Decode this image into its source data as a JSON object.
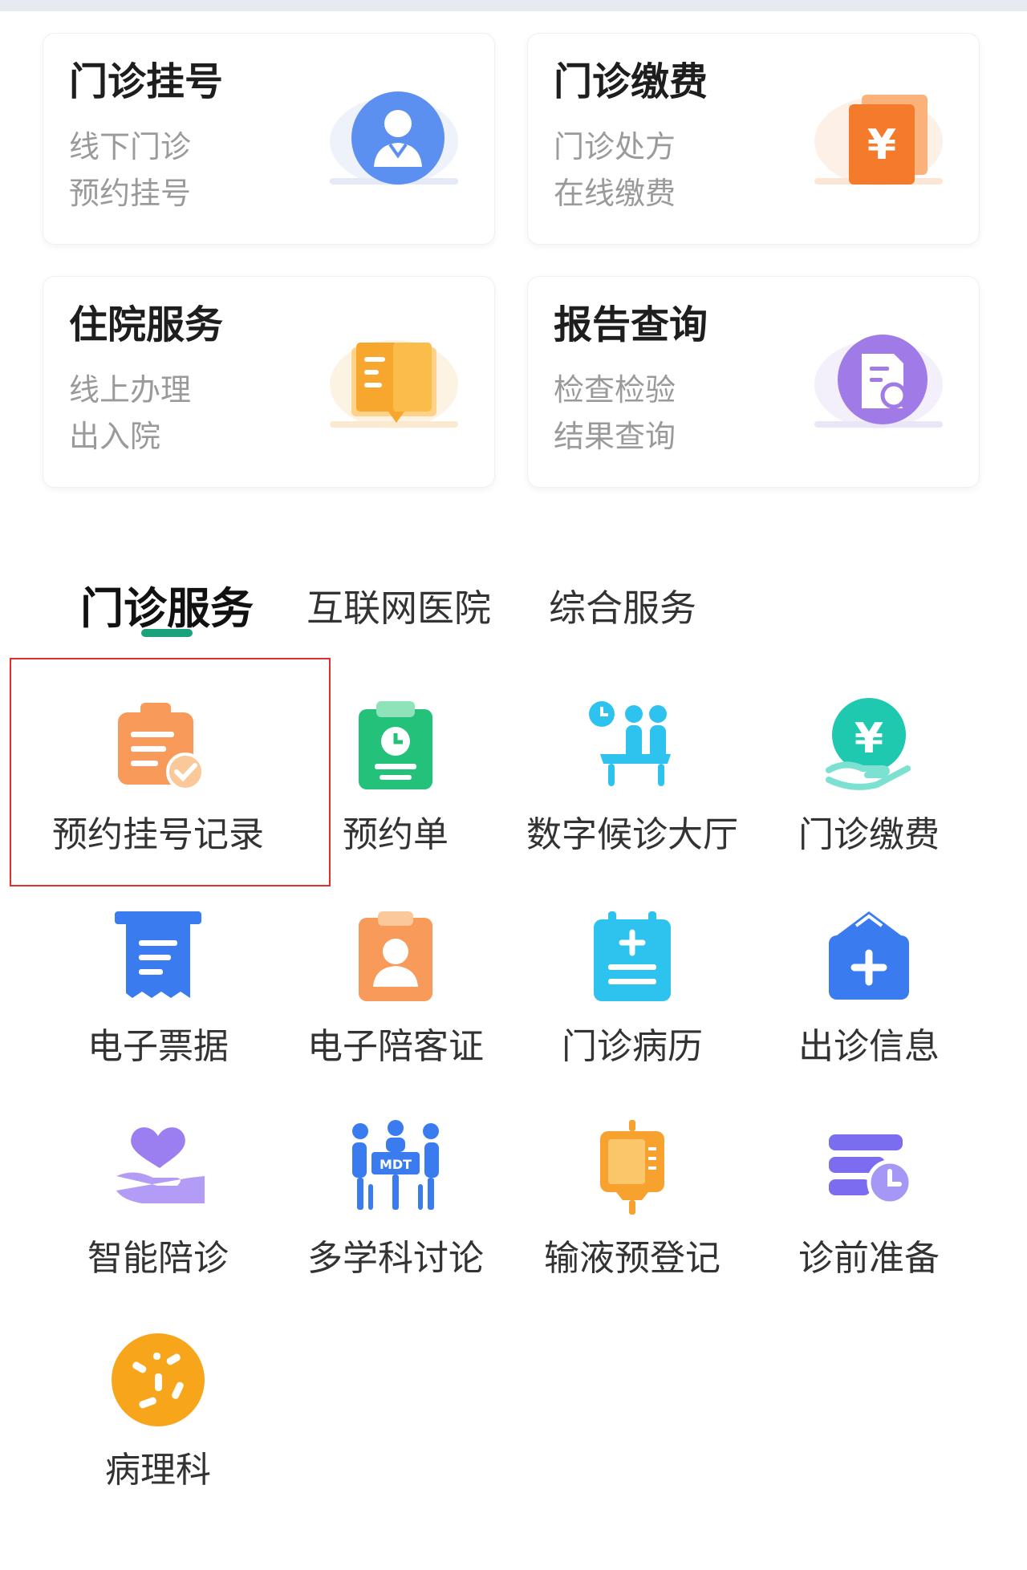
{
  "cards": [
    {
      "title": "门诊挂号",
      "sub1": "线下门诊",
      "sub2": "预约挂号",
      "icon": "doctor-icon"
    },
    {
      "title": "门诊缴费",
      "sub1": "门诊处方",
      "sub2": "在线缴费",
      "icon": "yuan-bill-icon"
    },
    {
      "title": "住院服务",
      "sub1": "线上办理",
      "sub2": "出入院",
      "icon": "book-icon"
    },
    {
      "title": "报告查询",
      "sub1": "检查检验",
      "sub2": "结果查询",
      "icon": "report-search-icon"
    }
  ],
  "tabs": [
    {
      "label": "门诊服务",
      "active": true
    },
    {
      "label": "互联网医院",
      "active": false
    },
    {
      "label": "综合服务",
      "active": false
    }
  ],
  "services": [
    {
      "label": "预约挂号记录",
      "icon": "clipboard-check-icon"
    },
    {
      "label": "预约单",
      "icon": "clock-clipboard-icon"
    },
    {
      "label": "数字候诊大厅",
      "icon": "waiting-room-icon"
    },
    {
      "label": "门诊缴费",
      "icon": "yuan-hand-icon"
    },
    {
      "label": "电子票据",
      "icon": "receipt-icon"
    },
    {
      "label": "电子陪客证",
      "icon": "id-badge-icon"
    },
    {
      "label": "门诊病历",
      "icon": "medical-record-icon"
    },
    {
      "label": "出诊信息",
      "icon": "clinic-house-icon"
    },
    {
      "label": "智能陪诊",
      "icon": "heart-hand-icon"
    },
    {
      "label": "多学科讨论",
      "icon": "mdt-meeting-icon"
    },
    {
      "label": "输液预登记",
      "icon": "iv-bag-icon"
    },
    {
      "label": "诊前准备",
      "icon": "schedule-icon"
    },
    {
      "label": "病理科",
      "icon": "pathology-icon"
    }
  ],
  "mdt_badge": "MDT",
  "colors": {
    "accent": "#1aa37a",
    "highlight": "#e42c2c"
  }
}
